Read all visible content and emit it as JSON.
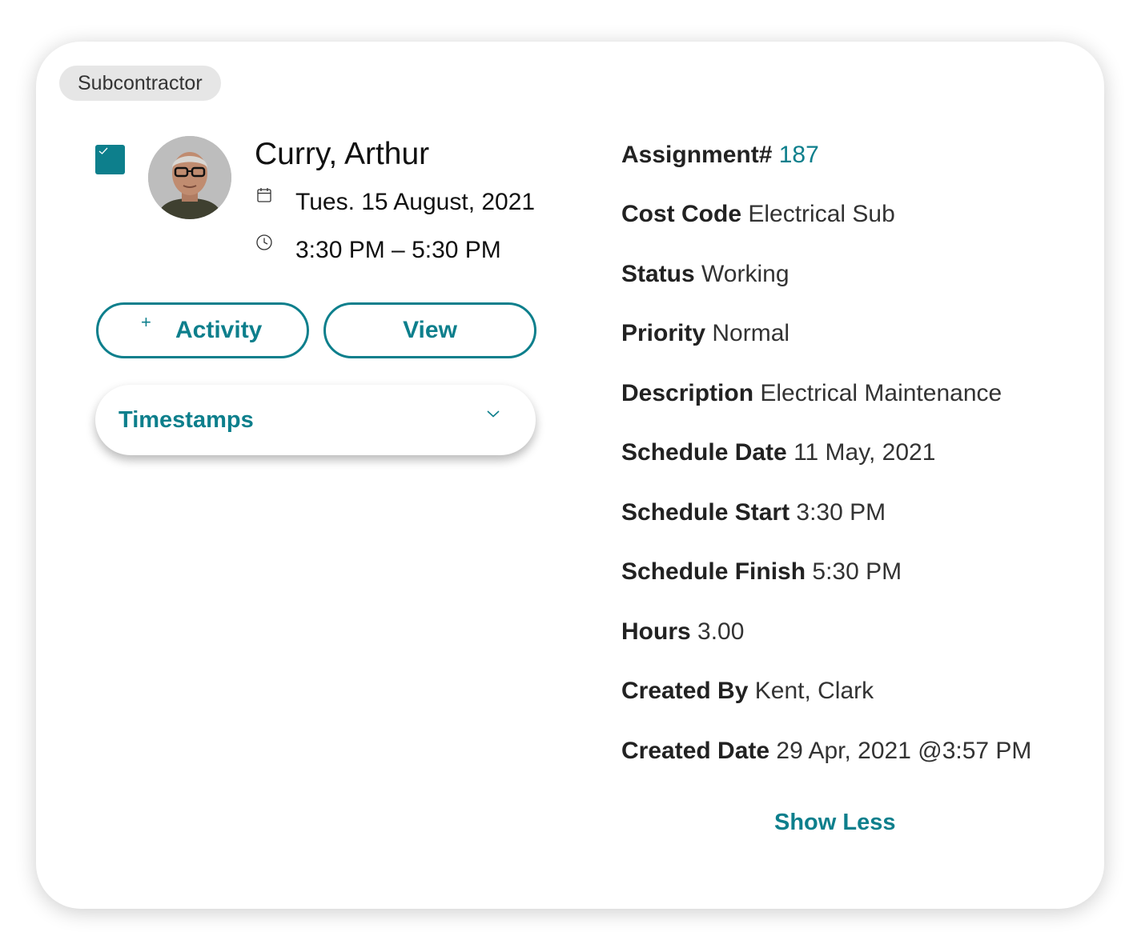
{
  "tag": "Subcontractor",
  "person": {
    "name": "Curry, Arthur",
    "date": "Tues. 15 August, 2021",
    "time": "3:30 PM – 5:30 PM"
  },
  "buttons": {
    "activity_icon": "+",
    "activity": "Activity",
    "view": "View"
  },
  "timestamps": {
    "label": "Timestamps"
  },
  "details": [
    {
      "label": "Assignment#",
      "value": "187",
      "link": true
    },
    {
      "label": "Cost Code",
      "value": "Electrical Sub"
    },
    {
      "label": "Status",
      "value": "Working"
    },
    {
      "label": "Priority",
      "value": "Normal"
    },
    {
      "label": "Description",
      "value": "Electrical Maintenance"
    },
    {
      "label": "Schedule Date",
      "value": "11 May, 2021"
    },
    {
      "label": "Schedule Start",
      "value": "3:30 PM"
    },
    {
      "label": "Schedule Finish",
      "value": "5:30 PM"
    },
    {
      "label": "Hours",
      "value": "3.00"
    },
    {
      "label": "Created By",
      "value": "Kent, Clark"
    },
    {
      "label": "Created Date",
      "value": "29 Apr, 2021 @3:57 PM"
    }
  ],
  "show_less": "Show Less",
  "colors": {
    "accent": "#0d7f8c",
    "tag_bg": "#e6e6e6",
    "text": "#333333"
  },
  "icons": [
    "check-icon",
    "calendar-icon",
    "clock-icon",
    "plus-icon",
    "chevron-down-icon"
  ]
}
